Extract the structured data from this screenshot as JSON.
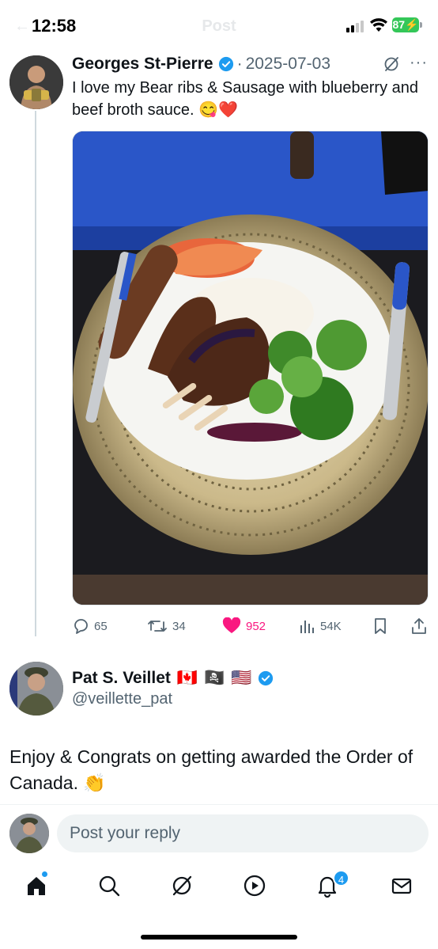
{
  "status_bar": {
    "time": "12:58",
    "battery": "87",
    "ghost_title": "Post"
  },
  "tweet": {
    "author_name": "Georges St-Pierre",
    "separator": "·",
    "date": "2025-07-03",
    "text": "I love my Bear ribs & Sausage with blueberry and beef broth sauce. 😋❤️",
    "media_alt": "Plate with bear ribs, sausage, rice, kimchi and broccoli in blueberry sauce",
    "stats": {
      "replies": "65",
      "reposts": "34",
      "likes": "952",
      "views": "54K"
    },
    "like_color": "#f91880"
  },
  "reply": {
    "author_name": "Pat S. Veillet",
    "flags": [
      "🇨🇦",
      "🏴‍☠️",
      "🇺🇸"
    ],
    "handle": "@veillette_pat",
    "text": "Enjoy & Congrats on getting awarded the Order of Canada. 👏"
  },
  "composer": {
    "placeholder": "Post your reply"
  },
  "tab_bar": {
    "items": [
      "home-icon",
      "search-icon",
      "grok-icon",
      "video-icon",
      "notifications-icon",
      "messages-icon"
    ],
    "notification_count": "4"
  },
  "colors": {
    "accent": "#1d9bf0",
    "secondary_text": "#536471",
    "battery": "#34c759"
  }
}
